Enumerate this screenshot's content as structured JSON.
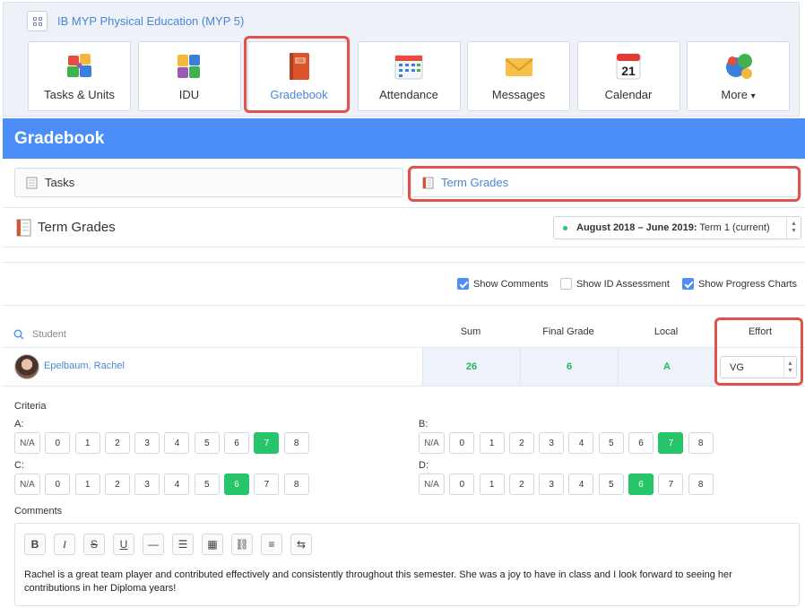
{
  "course": {
    "title": "IB MYP Physical Education (MYP 5)"
  },
  "nav_tiles": [
    {
      "label": "Tasks & Units"
    },
    {
      "label": "IDU"
    },
    {
      "label": "Gradebook"
    },
    {
      "label": "Attendance"
    },
    {
      "label": "Messages"
    },
    {
      "label": "Calendar",
      "day": "21"
    },
    {
      "label": "More",
      "caret": "▾"
    }
  ],
  "gradebook": {
    "title": "Gradebook"
  },
  "tabs": {
    "tasks": "Tasks",
    "term_grades": "Term Grades"
  },
  "term": {
    "title": "Term Grades",
    "period_bold": "August 2018 – June 2019:",
    "period_rest": " Term 1 (current)"
  },
  "options": {
    "show_comments": {
      "label": "Show Comments",
      "checked": true
    },
    "show_id": {
      "label": "Show ID Assessment",
      "checked": false
    },
    "show_charts": {
      "label": "Show Progress Charts",
      "checked": true
    }
  },
  "table": {
    "student_placeholder": "Student",
    "headers": {
      "sum": "Sum",
      "final": "Final Grade",
      "local": "Local",
      "effort": "Effort"
    },
    "row": {
      "name": "Epelbaum, Rachel",
      "sum": "26",
      "final": "6",
      "local": "A",
      "effort": "VG"
    }
  },
  "criteria": {
    "label": "Criteria",
    "na": "N/A",
    "scores": [
      "0",
      "1",
      "2",
      "3",
      "4",
      "5",
      "6",
      "7",
      "8"
    ],
    "A": {
      "letter": "A:",
      "selected": "7"
    },
    "B": {
      "letter": "B:",
      "selected": "7"
    },
    "C": {
      "letter": "C:",
      "selected": "6"
    },
    "D": {
      "letter": "D:",
      "selected": "6"
    }
  },
  "comments": {
    "label": "Comments",
    "toolbar": [
      "B",
      "I",
      "S",
      "U",
      "—",
      "☰",
      "▦",
      "⛓",
      "≡",
      "⇆"
    ],
    "text": "Rachel is a great team player and contributed effectively and consistently throughout this semester. She was a joy to have in class and I look forward to seeing her contributions in her Diploma years!"
  },
  "colors": {
    "accent": "#4c8ef7",
    "highlight": "#e0524c",
    "success": "#27c46a",
    "link": "#4a86d8"
  }
}
